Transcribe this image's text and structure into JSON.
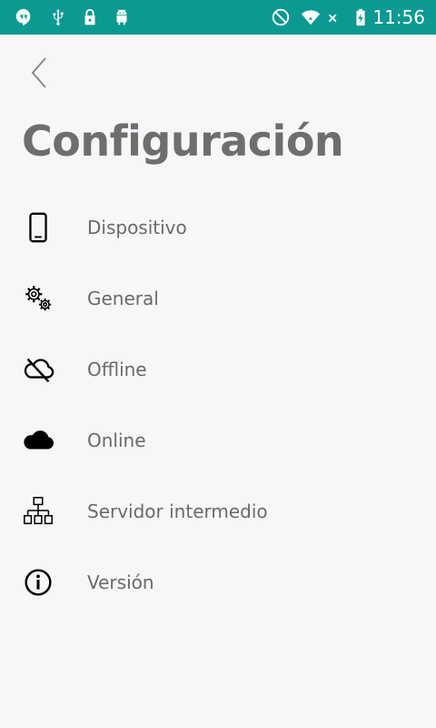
{
  "status_bar": {
    "time": "11:56",
    "icons": [
      "hangouts-icon",
      "usb-icon",
      "lock-icon",
      "android-icon",
      "dnd-icon",
      "wifi-icon",
      "no-signal-icon",
      "battery-charging-icon"
    ],
    "color": "#0a9a91"
  },
  "header": {
    "title": "Configuración"
  },
  "menu": {
    "items": [
      {
        "label": "Dispositivo",
        "icon": "phone-icon"
      },
      {
        "label": "General",
        "icon": "gears-icon"
      },
      {
        "label": "Offline",
        "icon": "cloud-off-icon"
      },
      {
        "label": "Online",
        "icon": "cloud-icon"
      },
      {
        "label": "Servidor intermedio",
        "icon": "network-icon"
      },
      {
        "label": "Versión",
        "icon": "info-icon"
      }
    ]
  }
}
